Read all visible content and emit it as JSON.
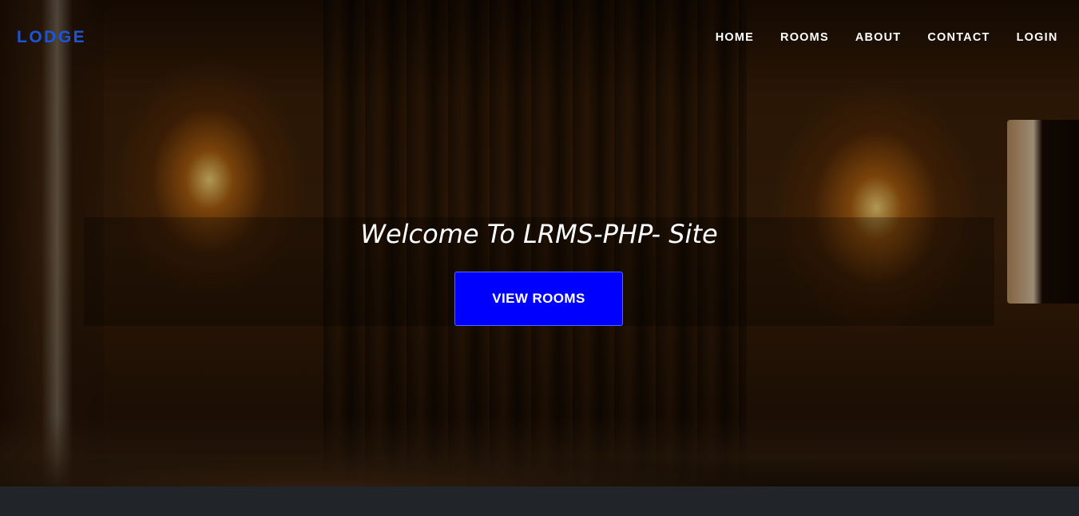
{
  "navbar": {
    "brand": "LODGE",
    "links": [
      "HOME",
      "ROOMS",
      "ABOUT",
      "CONTACT",
      "LOGIN"
    ]
  },
  "hero": {
    "welcome": "Welcome To LRMS-PHP- Site",
    "button_label": "VIEW ROOMS"
  },
  "colors": {
    "brand": "#1a56db",
    "button": "#0000ff",
    "footer": "#212529"
  }
}
